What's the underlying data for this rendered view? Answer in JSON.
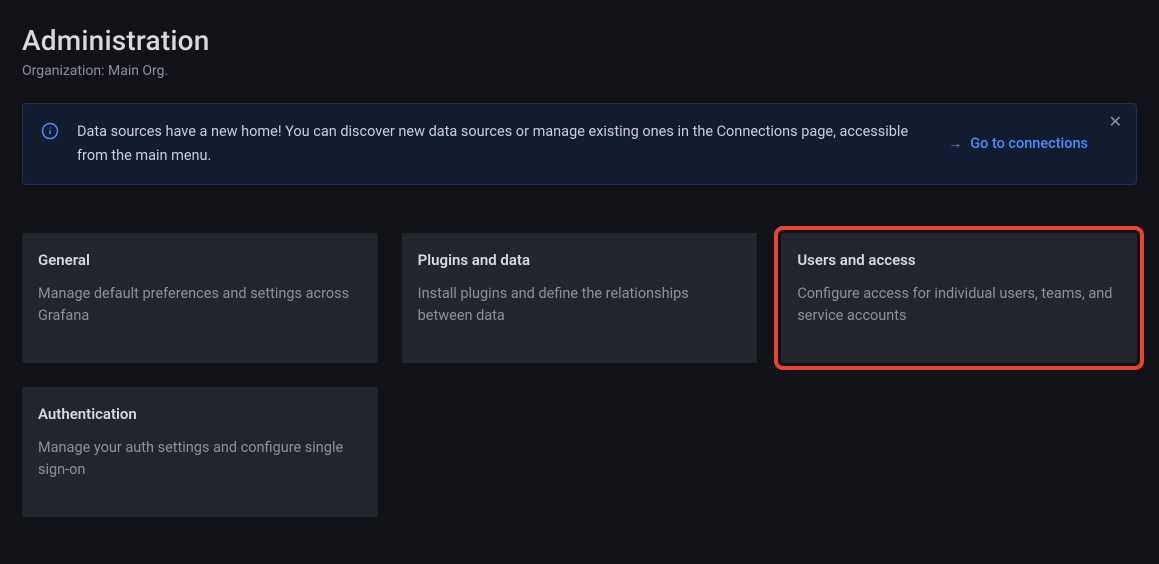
{
  "header": {
    "title": "Administration",
    "subtitle": "Organization: Main Org."
  },
  "banner": {
    "text": "Data sources have a new home! You can discover new data sources or manage existing ones in the Connections page, accessible from the main menu.",
    "link_label": "Go to connections"
  },
  "cards": [
    {
      "title": "General",
      "desc": "Manage default preferences and settings across Grafana",
      "highlighted": false
    },
    {
      "title": "Plugins and data",
      "desc": "Install plugins and define the relationships between data",
      "highlighted": false
    },
    {
      "title": "Users and access",
      "desc": "Configure access for individual users, teams, and service accounts",
      "highlighted": true
    },
    {
      "title": "Authentication",
      "desc": "Manage your auth settings and configure single sign-on",
      "highlighted": false
    }
  ]
}
